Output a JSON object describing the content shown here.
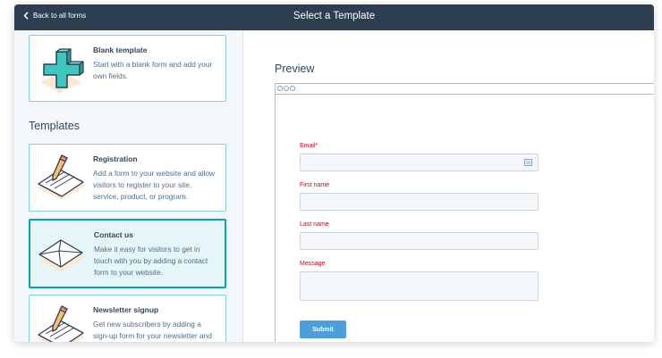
{
  "header": {
    "back_label": "Back to all forms",
    "title": "Select a Template"
  },
  "sidebar": {
    "blank": {
      "title": "Blank template",
      "description": "Start with a blank form and add your own fields."
    },
    "section_title": "Templates",
    "templates": [
      {
        "title": "Registration",
        "description": "Add a form to your website and allow visitors to register to your site, service, product, or program."
      },
      {
        "title": "Contact us",
        "description": "Make it easy for visitors to get in touch with you by adding a contact form to your website."
      },
      {
        "title": "Newsletter signup",
        "description": "Get new subscribers by adding a sign-up form for your newsletter and keep them up to date on the"
      }
    ],
    "selected_index": 1
  },
  "preview": {
    "label": "Preview",
    "fields": [
      {
        "label": "Email*"
      },
      {
        "label": "First name"
      },
      {
        "label": "Last name"
      },
      {
        "label": "Message"
      }
    ],
    "submit_label": "Submit"
  },
  "colors": {
    "topbar": "#2d3e50",
    "accent": "#00a4bd",
    "label_red": "#d0021b",
    "submit": "#4a9fdc"
  }
}
